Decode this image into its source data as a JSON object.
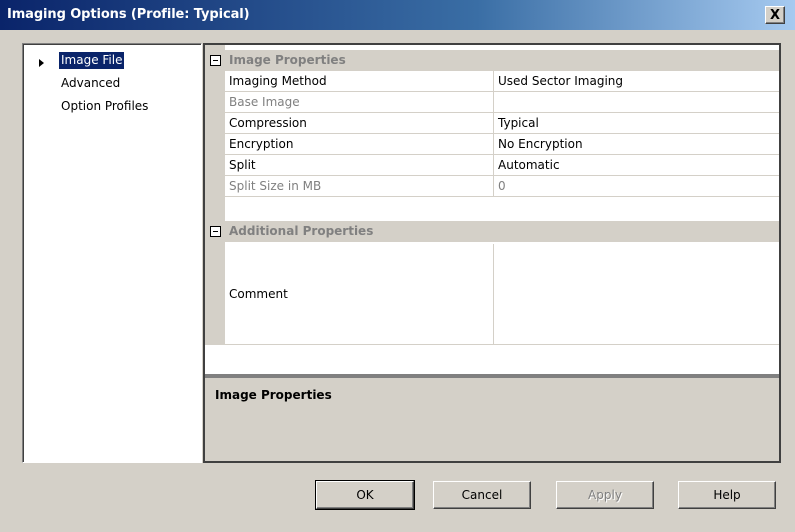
{
  "window": {
    "title": "Imaging Options (Profile: Typical)",
    "close_label": "X"
  },
  "tree": {
    "items": [
      {
        "label": "Image File",
        "selected": true
      },
      {
        "label": "Advanced",
        "selected": false
      },
      {
        "label": "Option Profiles",
        "selected": false
      }
    ]
  },
  "grid": {
    "categories": [
      {
        "label": "Image Properties"
      },
      {
        "label": "Additional Properties"
      }
    ],
    "rows": [
      {
        "name": "Imaging Method",
        "value": "Used Sector Imaging",
        "enabled": true
      },
      {
        "name": "Base Image",
        "value": "",
        "enabled": false
      },
      {
        "name": "Compression",
        "value": "Typical",
        "enabled": true
      },
      {
        "name": "Encryption",
        "value": "No Encryption",
        "enabled": true
      },
      {
        "name": "Split",
        "value": "Automatic",
        "enabled": true
      },
      {
        "name": "Split Size in MB",
        "value": "0",
        "enabled": false
      }
    ],
    "comment": {
      "name": "Comment",
      "value": ""
    }
  },
  "description": {
    "title": "Image Properties"
  },
  "buttons": {
    "ok": "OK",
    "cancel": "Cancel",
    "apply": "Apply",
    "help": "Help"
  }
}
